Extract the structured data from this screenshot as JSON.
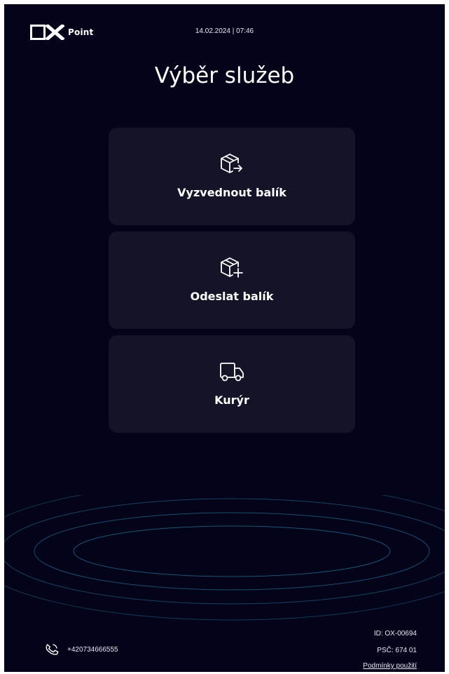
{
  "brand": {
    "logo_text": "Point"
  },
  "header": {
    "datetime": "14.02.2024 | 07:46"
  },
  "page": {
    "title": "Výběr služeb"
  },
  "services": [
    {
      "label": "Vyzvednout balík",
      "icon": "package-pickup-icon"
    },
    {
      "label": "Odeslat balík",
      "icon": "package-send-icon"
    },
    {
      "label": "Kurýr",
      "icon": "truck-icon"
    }
  ],
  "footer": {
    "phone": "+420734666555",
    "phone_icon": "phone-icon",
    "kiosk_id": "ID: OX-00694",
    "postal_code": "PSČ: 674 01",
    "terms_link": "Podmínky použití"
  },
  "colors": {
    "background": "#03031a",
    "card": "#141428",
    "ring": "#1f5a7a"
  }
}
